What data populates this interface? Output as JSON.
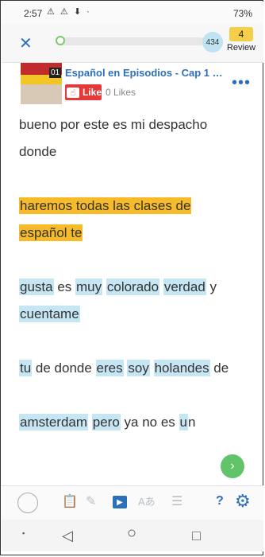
{
  "status": {
    "time": "2:57",
    "icons": "⚠ ⚠ ⬇ ·",
    "battery": "73%"
  },
  "toolbar": {
    "close": "✕",
    "count": "434",
    "review_count": "4",
    "review_label": "Review"
  },
  "lesson": {
    "thumb_number": "01",
    "title": "Español en Episodios - Cap 1 U...",
    "like_label": "Like",
    "likes": "0 Likes",
    "more": "•••"
  },
  "reader": {
    "lines": [
      [
        {
          "t": "bueno por este es mi despacho",
          "k": ""
        }
      ],
      [
        {
          "t": "donde",
          "k": ""
        }
      ],
      [],
      [
        {
          "t": "haremos todas las clases de",
          "k": "hl"
        }
      ],
      [
        {
          "t": "español te",
          "k": "hl"
        }
      ],
      [],
      [
        {
          "t": "gusta",
          "k": "ku"
        },
        {
          "t": " es ",
          "k": ""
        },
        {
          "t": "muy",
          "k": "ku"
        },
        {
          "t": " ",
          "k": ""
        },
        {
          "t": "colorado",
          "k": "ku"
        },
        {
          "t": " ",
          "k": ""
        },
        {
          "t": "verdad",
          "k": "ku"
        },
        {
          "t": " y",
          "k": ""
        }
      ],
      [
        {
          "t": "cuentame",
          "k": "ku"
        }
      ],
      [],
      [
        {
          "t": "tu",
          "k": "ku"
        },
        {
          "t": " de donde ",
          "k": ""
        },
        {
          "t": "eres",
          "k": "ku"
        },
        {
          "t": " ",
          "k": ""
        },
        {
          "t": "soy",
          "k": "ku"
        },
        {
          "t": " ",
          "k": ""
        },
        {
          "t": "holandes",
          "k": "ku"
        },
        {
          "t": " de",
          "k": ""
        }
      ],
      [],
      [
        {
          "t": "amsterdam",
          "k": "ku"
        },
        {
          "t": " ",
          "k": ""
        },
        {
          "t": "pero",
          "k": "ku"
        },
        {
          "t": " ya no es ",
          "k": ""
        },
        {
          "t": "u",
          "k": "ku"
        },
        {
          "t": "n",
          "k": ""
        }
      ]
    ]
  },
  "next": "›",
  "bottom": {
    "help": "?",
    "gear": "⚙",
    "play": "▶",
    "translate": "Aあ",
    "list": "☰"
  },
  "nav": {
    "back": "◁",
    "home": "○",
    "recent": "□",
    "dot": "▪"
  }
}
